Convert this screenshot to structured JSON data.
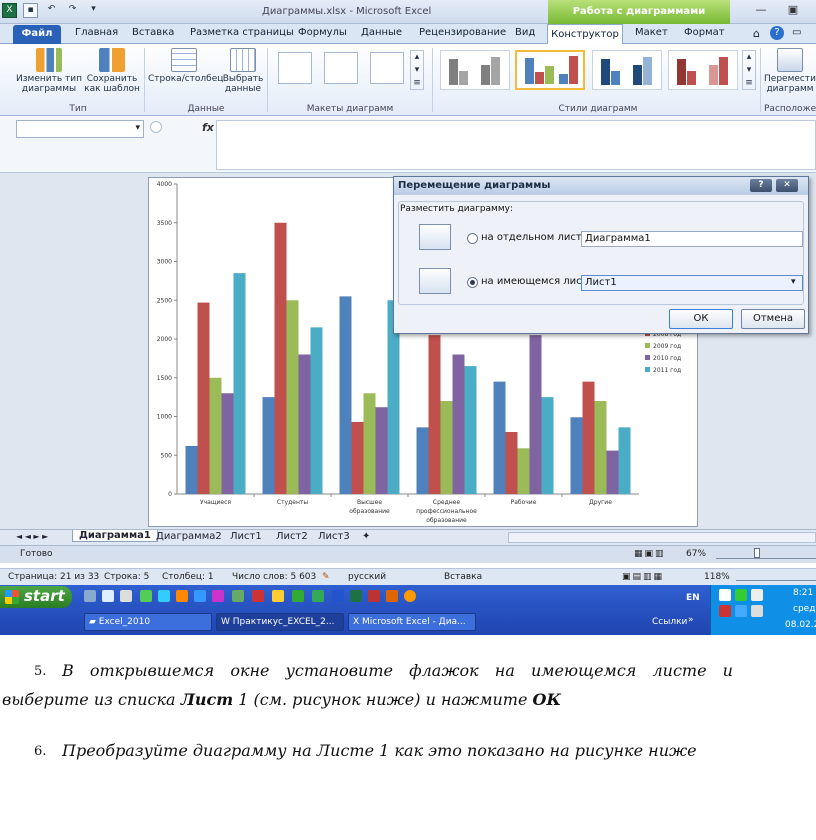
{
  "window": {
    "title": "Диаграммы.xlsx - Microsoft Excel",
    "context_tab": "Работа с диаграммами",
    "min": "—",
    "max": "▣"
  },
  "tabs": {
    "file": "Файл",
    "items": [
      "Главная",
      "Вставка",
      "Разметка страницы",
      "Формулы",
      "Данные",
      "Рецензирование",
      "Вид"
    ],
    "design": "Конструктор",
    "layout": "Макет",
    "format": "Формат"
  },
  "ribbon": {
    "change_type_l1": "Изменить тип",
    "change_type_l2": "диаграммы",
    "save_tpl_l1": "Сохранить",
    "save_tpl_l2": "как шаблон",
    "group_type": "Тип",
    "row_col": "Строка/столбец",
    "select_l1": "Выбрать",
    "select_l2": "данные",
    "group_data": "Данные",
    "group_layouts": "Макеты диаграмм",
    "group_styles": "Стили диаграмм",
    "move_l1": "Перемести",
    "move_l2": "диаграмм",
    "group_location": "Расположе"
  },
  "formula": {
    "fx": "fx"
  },
  "chart_data": {
    "type": "bar",
    "categories": [
      "Учащиеся",
      "Студенты",
      "Высшее образование",
      "Среднее профессиональное образование",
      "Рабочие",
      "Другие"
    ],
    "category_lines": [
      [
        "Учащиеся"
      ],
      [
        "Студенты"
      ],
      [
        "Высшее",
        "образование"
      ],
      [
        "Среднее",
        "профессиональное",
        "образование"
      ],
      [
        "Рабочие"
      ],
      [
        "Другие"
      ]
    ],
    "ylim": [
      0,
      4000
    ],
    "yticks": [
      0,
      500,
      1000,
      1500,
      2000,
      2500,
      3000,
      3500,
      4000
    ],
    "series": [
      {
        "values": [
          620,
          1250,
          2550,
          860,
          1450,
          990
        ],
        "color": "#4f81bd"
      },
      {
        "name": "2008 год",
        "values": [
          2470,
          3500,
          930,
          2050,
          800,
          1450
        ],
        "color": "#c0504d"
      },
      {
        "name": "2009 год",
        "values": [
          1500,
          2500,
          1300,
          1200,
          590,
          1200
        ],
        "color": "#9bbb59"
      },
      {
        "name": "2010 год",
        "values": [
          1300,
          1800,
          1120,
          1800,
          2050,
          560
        ],
        "color": "#8064a2"
      },
      {
        "name": "2011 год",
        "values": [
          2850,
          2150,
          2500,
          1650,
          1250,
          860
        ],
        "color": "#4bacc6"
      }
    ],
    "legend": "right"
  },
  "dialog": {
    "title": "Перемещение диаграммы",
    "help": "?",
    "close": "✕",
    "prompt": "Разместить диаграмму:",
    "opt_new": "на отдельном листе:",
    "new_value": "Диаграмма1",
    "opt_existing": "на имеющемся листе:",
    "existing_value": "Лист1",
    "ok": "ОК",
    "cancel": "Отмена"
  },
  "sheets": {
    "nav": "◄ ◄ ► ►",
    "active": "Диаграмма1",
    "items": [
      "Диаграмма2",
      "Лист1",
      "Лист2",
      "Лист3"
    ]
  },
  "status": {
    "ready": "Готово",
    "zoom": "67%"
  },
  "word_status": {
    "page": "Страница: 21 из 33",
    "line": "Строка: 5",
    "column": "Столбец: 1",
    "words": "Число слов: 5 603",
    "lang": "русский",
    "mode": "Вставка",
    "zoom": "118%"
  },
  "taskbar": {
    "start": "start",
    "tasks": [
      "Excel_2010",
      "Практикус_EXCEL_2...",
      "Microsoft Excel - Диа..."
    ],
    "links": "Ссылки",
    "lang": "EN",
    "time": "8:21",
    "day": "среда",
    "date": "08.02.2"
  },
  "doc": {
    "step5_num": "5.",
    "step5_line1": "В открывшемся окне установите флажок на имеющемся листе и",
    "step5_line2a": "выберите из списка ",
    "step5_bold1": "Лист",
    "step5_line2b": " 1 (см. рисунок ниже) и нажмите ",
    "step5_bold2": "ОК",
    "step6_num": "6.",
    "step6_text": "Преобразуйте диаграмму на Листе 1 как это показано на рисунке ниже"
  }
}
